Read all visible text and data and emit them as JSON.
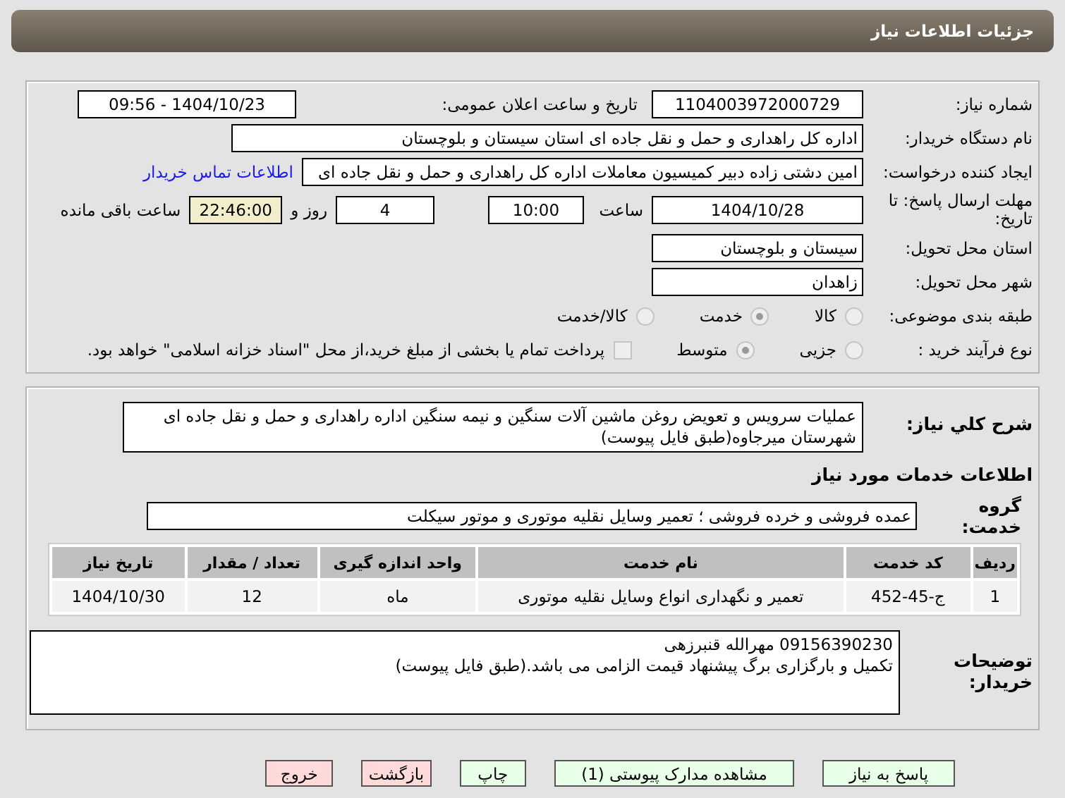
{
  "header": {
    "title": "جزئیات اطلاعات نیاز"
  },
  "need": {
    "number_label": "شماره نیاز:",
    "number": "1104003972000729",
    "announce_label": "تاریخ و ساعت اعلان عمومی:",
    "announce": "1404/10/23 - 09:56",
    "buyer_label": "نام دستگاه خریدار:",
    "buyer": "اداره کل راهداری و حمل و نقل جاده ای استان سیستان و بلوچستان",
    "creator_label": "ایجاد کننده درخواست:",
    "creator": "امین دشتی زاده دبیر کمیسیون معاملات اداره کل راهداری و حمل و نقل جاده ای",
    "contact_link": "اطلاعات تماس خریدار",
    "deadline_label": "مهلت ارسال پاسخ: تا تاریخ:",
    "deadline_date": "1404/10/28",
    "time_label": "ساعت",
    "deadline_time": "10:00",
    "days": "4",
    "days_label": "روز و",
    "remaining": "22:46:00",
    "remaining_label": "ساعت باقی مانده",
    "province_label": "استان محل تحویل:",
    "province": "سیستان و بلوچستان",
    "city_label": "شهر محل تحویل:",
    "city": "زاهدان",
    "category_label": "طبقه بندی موضوعی:",
    "category_options": [
      {
        "label": "کالا",
        "selected": false
      },
      {
        "label": "خدمت",
        "selected": true
      },
      {
        "label": "کالا/خدمت",
        "selected": false
      }
    ],
    "process_label": "نوع فرآیند خرید :",
    "process_options": [
      {
        "label": "جزیی",
        "selected": false
      },
      {
        "label": "متوسط",
        "selected": true
      }
    ],
    "treasury": {
      "checked": false,
      "text": "پرداخت تمام یا بخشی از مبلغ خرید،از محل \"اسناد خزانه اسلامی\" خواهد بود."
    }
  },
  "details": {
    "description_label": "شرح کلي نياز:",
    "description": "عملیات سرویس و تعویض روغن ماشین آلات سنگین و نیمه سنگین اداره راهداری و حمل و نقل جاده ای شهرستان میرجاوه(طبق فایل پیوست)",
    "services_heading": "اطلاعات خدمات مورد نیاز",
    "group_label": "گروه خدمت:",
    "group": "عمده فروشی و خرده فروشی ؛ تعمیر وسایل نقلیه موتوری و موتور سیکلت",
    "table": {
      "columns": [
        "ردیف",
        "کد خدمت",
        "نام خدمت",
        "واحد اندازه گیری",
        "تعداد / مقدار",
        "تاریخ نیاز"
      ],
      "rows": [
        [
          "1",
          "ج-45-452",
          "تعمیر و نگهداری انواع وسایل نقلیه موتوری",
          "ماه",
          "12",
          "1404/10/30"
        ]
      ]
    },
    "notes_label": "توضیحات خریدار:",
    "notes": [
      "09156390230  مهرالله قنبرزهی",
      "تکمیل و بارگزاری برگ پیشنهاد قیمت الزامی می باشد.(طبق فایل پیوست)"
    ]
  },
  "buttons": [
    {
      "label": "پاسخ به نیاز",
      "kind": "action"
    },
    {
      "label": "مشاهده مدارک پیوستی (1)",
      "kind": "action"
    },
    {
      "label": "چاپ",
      "kind": "action"
    },
    {
      "label": "بازگشت",
      "kind": "exit"
    },
    {
      "label": "خروج",
      "kind": "exit"
    }
  ]
}
